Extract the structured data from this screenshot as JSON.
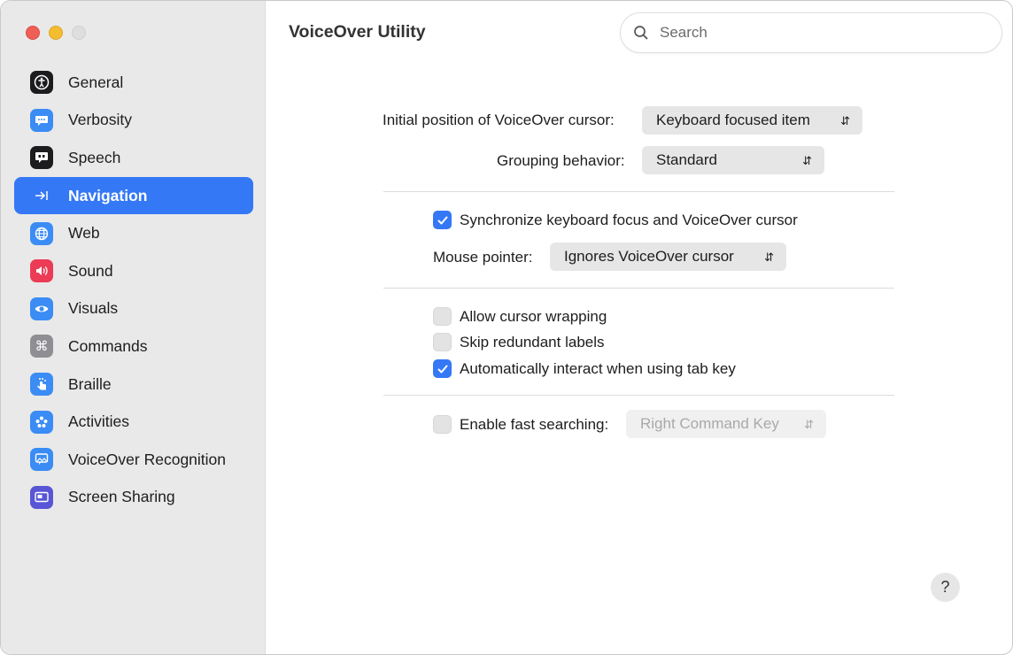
{
  "window": {
    "title": "VoiceOver Utility"
  },
  "search": {
    "placeholder": "Search"
  },
  "sidebar": {
    "items": [
      {
        "label": "General",
        "icon": "accessibility-icon",
        "color": "#1c1c1e",
        "active": false
      },
      {
        "label": "Verbosity",
        "icon": "speech-bubble-icon",
        "color": "#3b8cf4",
        "active": false
      },
      {
        "label": "Speech",
        "icon": "speech-quote-icon",
        "color": "#1c1c1e",
        "active": false
      },
      {
        "label": "Navigation",
        "icon": "arrow-to-line-icon",
        "color": "#3478f6",
        "active": true
      },
      {
        "label": "Web",
        "icon": "globe-icon",
        "color": "#3b8cf4",
        "active": false
      },
      {
        "label": "Sound",
        "icon": "speaker-icon",
        "color": "#ec3b55",
        "active": false
      },
      {
        "label": "Visuals",
        "icon": "eye-icon",
        "color": "#3b8cf4",
        "active": false
      },
      {
        "label": "Commands",
        "icon": "command-icon",
        "color": "#8e8e93",
        "active": false
      },
      {
        "label": "Braille",
        "icon": "braille-hand-icon",
        "color": "#3b8cf4",
        "active": false
      },
      {
        "label": "Activities",
        "icon": "activities-icon",
        "color": "#3b8cf4",
        "active": false
      },
      {
        "label": "VoiceOver Recognition",
        "icon": "image-recognition-icon",
        "color": "#3b8cf4",
        "active": false
      },
      {
        "label": "Screen Sharing",
        "icon": "screen-sharing-icon",
        "color": "#5856d6",
        "active": false
      }
    ]
  },
  "settings": {
    "initial_position": {
      "label": "Initial position of VoiceOver cursor:",
      "value": "Keyboard focused item"
    },
    "grouping": {
      "label": "Grouping behavior:",
      "value": "Standard"
    },
    "sync_focus": {
      "label": "Synchronize keyboard focus and VoiceOver cursor",
      "checked": true
    },
    "mouse_pointer": {
      "label": "Mouse pointer:",
      "value": "Ignores VoiceOver cursor"
    },
    "cursor_wrapping": {
      "label": "Allow cursor wrapping",
      "checked": false
    },
    "skip_labels": {
      "label": "Skip redundant labels",
      "checked": false
    },
    "auto_interact": {
      "label": "Automatically interact when using tab key",
      "checked": true
    },
    "fast_search": {
      "label": "Enable fast searching:",
      "checked": false,
      "value": "Right Command Key"
    }
  },
  "help": {
    "label": "?"
  },
  "colors": {
    "accent": "#3478f6",
    "sidebar_bg": "#e9e9e9"
  }
}
